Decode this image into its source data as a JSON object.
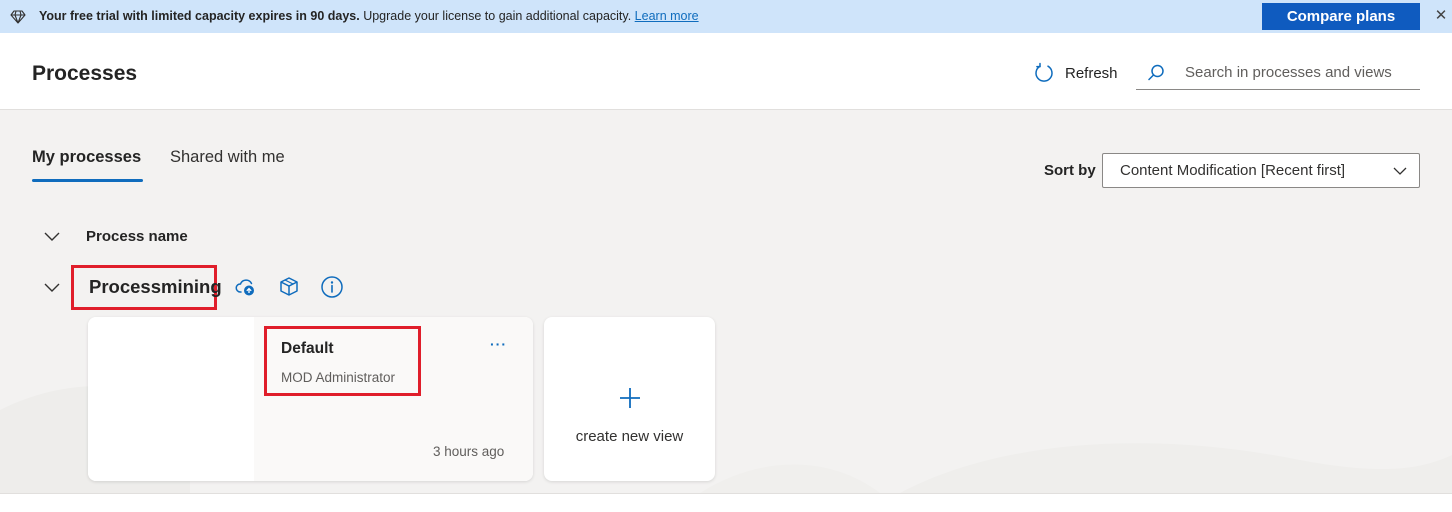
{
  "banner": {
    "bold": "Your free trial with limited capacity expires in 90 days.",
    "text": " Upgrade your license to gain additional capacity. ",
    "link": "Learn more",
    "button": "Compare plans",
    "close": "✕"
  },
  "header": {
    "title": "Processes",
    "refresh": "Refresh",
    "search_placeholder": "Search in processes and views"
  },
  "tabs": [
    {
      "label": "My processes",
      "active": true
    },
    {
      "label": "Shared with me",
      "active": false
    }
  ],
  "sort": {
    "label": "Sort by",
    "value": "Content Modification [Recent first]"
  },
  "list": {
    "column_header": "Process name",
    "groups": [
      {
        "name": "Processmining",
        "icons": [
          "cloud-upload-icon",
          "package-icon",
          "info-icon"
        ],
        "views": [
          {
            "name": "Default",
            "owner": "MOD Administrator",
            "modified": "3 hours ago",
            "more": "···"
          }
        ],
        "new_view_label": "create new view"
      }
    ]
  },
  "colors": {
    "accent": "#0f6cbd",
    "banner_bg": "#cfe4fa",
    "highlight": "#e01e2b",
    "surface": "#f3f2f1"
  }
}
